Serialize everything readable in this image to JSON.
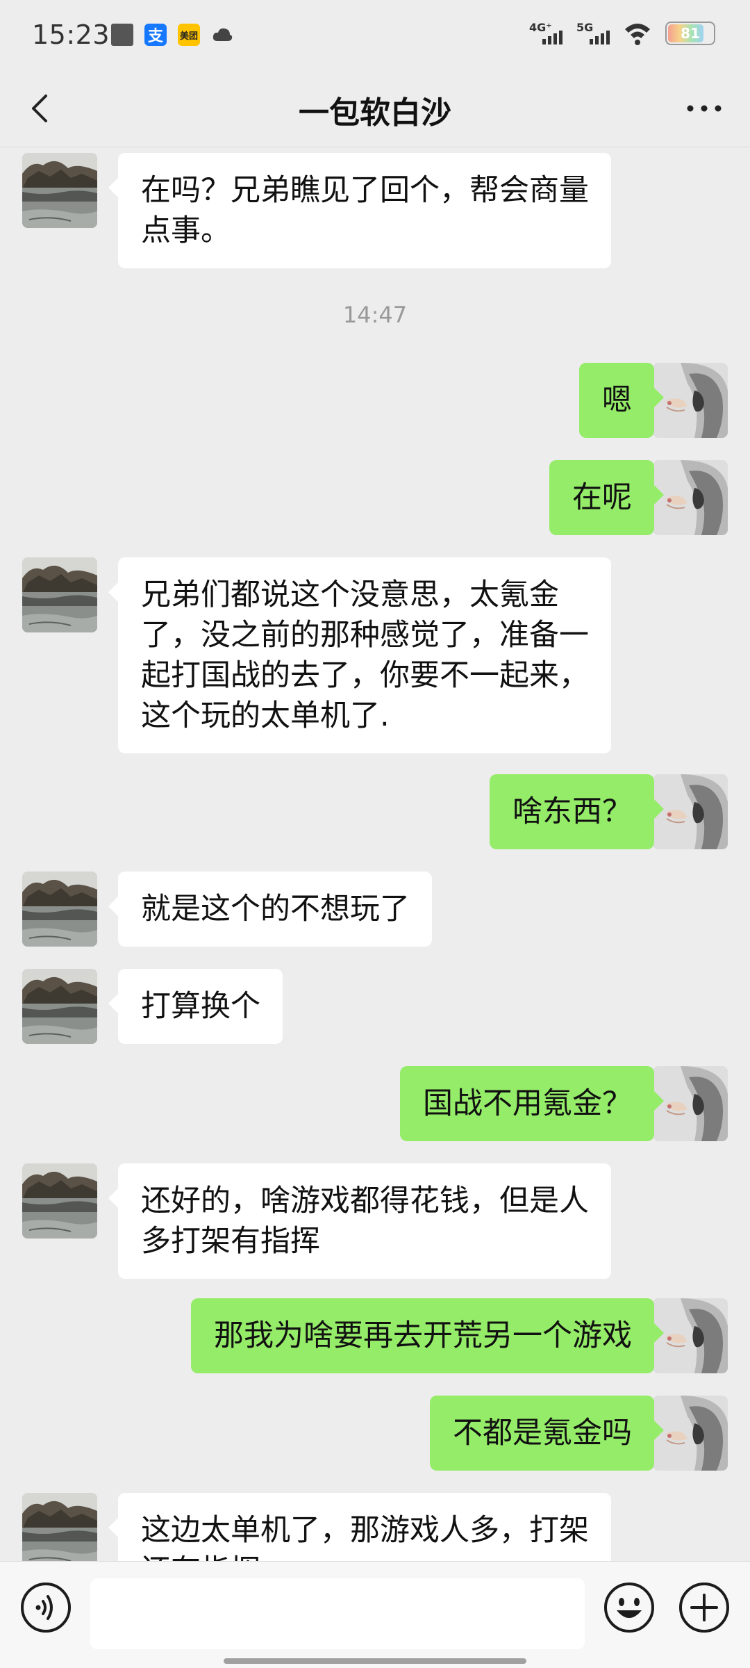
{
  "status_bar": {
    "time": "15:23",
    "notification_icons": [
      "gallery-icon",
      "alipay-icon",
      "meituan-icon",
      "cloud-icon"
    ],
    "meituan_label": "美团",
    "alipay_label": "支",
    "signal_1_label": "4G⁺",
    "signal_2_label": "5G",
    "battery_level": "81"
  },
  "nav": {
    "title": "一包软白沙",
    "back_icon": "chevron-left-icon",
    "more_icon": "more-dots-icon"
  },
  "chat": {
    "timestamp": "14:47",
    "messages": [
      {
        "sender": "contact",
        "lines": [
          "在吗？兄弟瞧见了回个，帮会商量",
          "点事。"
        ]
      },
      {
        "sender": "me",
        "lines": [
          "嗯"
        ]
      },
      {
        "sender": "me",
        "lines": [
          "在呢"
        ]
      },
      {
        "sender": "contact",
        "lines": [
          "兄弟们都说这个没意思，太氪金",
          "了，没之前的那种感觉了，准备一",
          "起打国战的去了，你要不一起来，",
          "这个玩的太单机了."
        ]
      },
      {
        "sender": "me",
        "lines": [
          "啥东西？"
        ]
      },
      {
        "sender": "contact",
        "lines": [
          "就是这个的不想玩了"
        ]
      },
      {
        "sender": "contact",
        "lines": [
          "打算换个"
        ]
      },
      {
        "sender": "me",
        "lines": [
          "国战不用氪金？"
        ]
      },
      {
        "sender": "contact",
        "lines": [
          "还好的，啥游戏都得花钱，但是人",
          "多打架有指挥"
        ]
      },
      {
        "sender": "me",
        "lines": [
          "那我为啥要再去开荒另一个游戏"
        ]
      },
      {
        "sender": "me",
        "lines": [
          "不都是氪金吗"
        ]
      },
      {
        "sender": "contact",
        "lines": [
          "这边太单机了，那游戏人多，打架",
          "还有指挥"
        ]
      }
    ]
  },
  "input_bar": {
    "voice_icon": "voice-icon",
    "emoji_icon": "emoji-icon",
    "plus_icon": "plus-circle-icon",
    "placeholder": ""
  },
  "colors": {
    "background": "#ededed",
    "bubble_in": "#ffffff",
    "bubble_out": "#95ec69",
    "timestamp": "#999999"
  }
}
